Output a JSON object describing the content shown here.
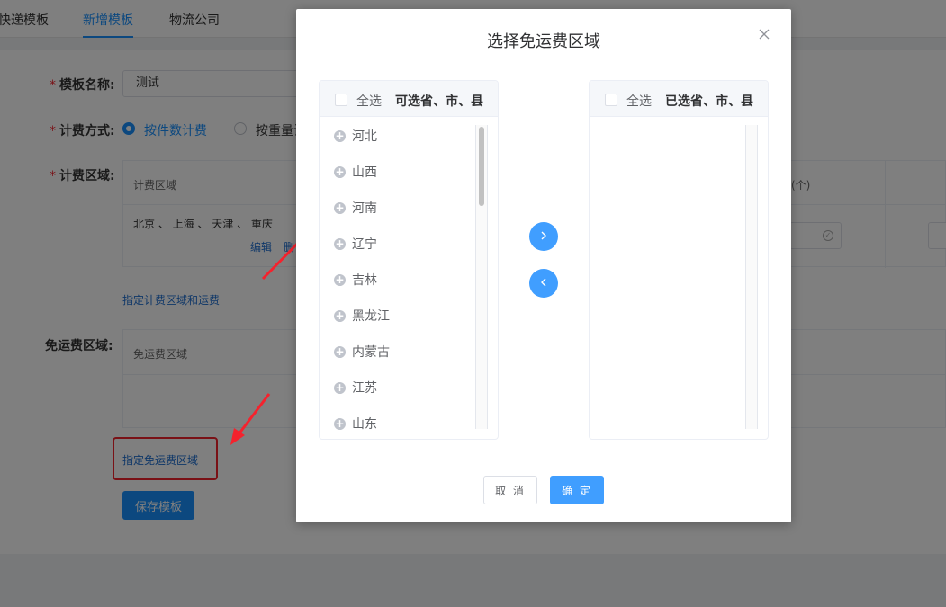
{
  "tabs": [
    {
      "label": "快递模板"
    },
    {
      "label": "新增模板"
    },
    {
      "label": "物流公司"
    }
  ],
  "form": {
    "name_label": "模板名称:",
    "name_value": "测试",
    "fee_mode_label": "计费方式:",
    "fee_mode_option_1": "按件数计费",
    "fee_mode_option_2": "按重量计",
    "fee_area_label": "计费区域:",
    "fee_table_header": "计费区域",
    "fee_table_right_header": "(个)",
    "fee_table_cities": "北京 、 上海 、 天津 、 重庆",
    "edit_link": "编辑",
    "delete_link_fragment": "删",
    "assign_fee_area_link": "指定计费区域和运费",
    "free_area_label": "免运费区域:",
    "free_table_header": "免运费区域",
    "assign_free_area_link": "指定免运费区域",
    "save_button": "保存模板"
  },
  "dialog": {
    "title": "选择免运费区域",
    "left_panel": {
      "select_all": "全选",
      "title": "可选省、市、县",
      "items": [
        "河北",
        "山西",
        "河南",
        "辽宁",
        "吉林",
        "黑龙江",
        "内蒙古",
        "江苏",
        "山东"
      ]
    },
    "right_panel": {
      "select_all": "全选",
      "title": "已选省、市、县",
      "items": []
    },
    "cancel_button": "取 消",
    "ok_button": "确 定"
  },
  "colors": {
    "primary": "#409eff",
    "annotation_red": "#f5222d"
  }
}
